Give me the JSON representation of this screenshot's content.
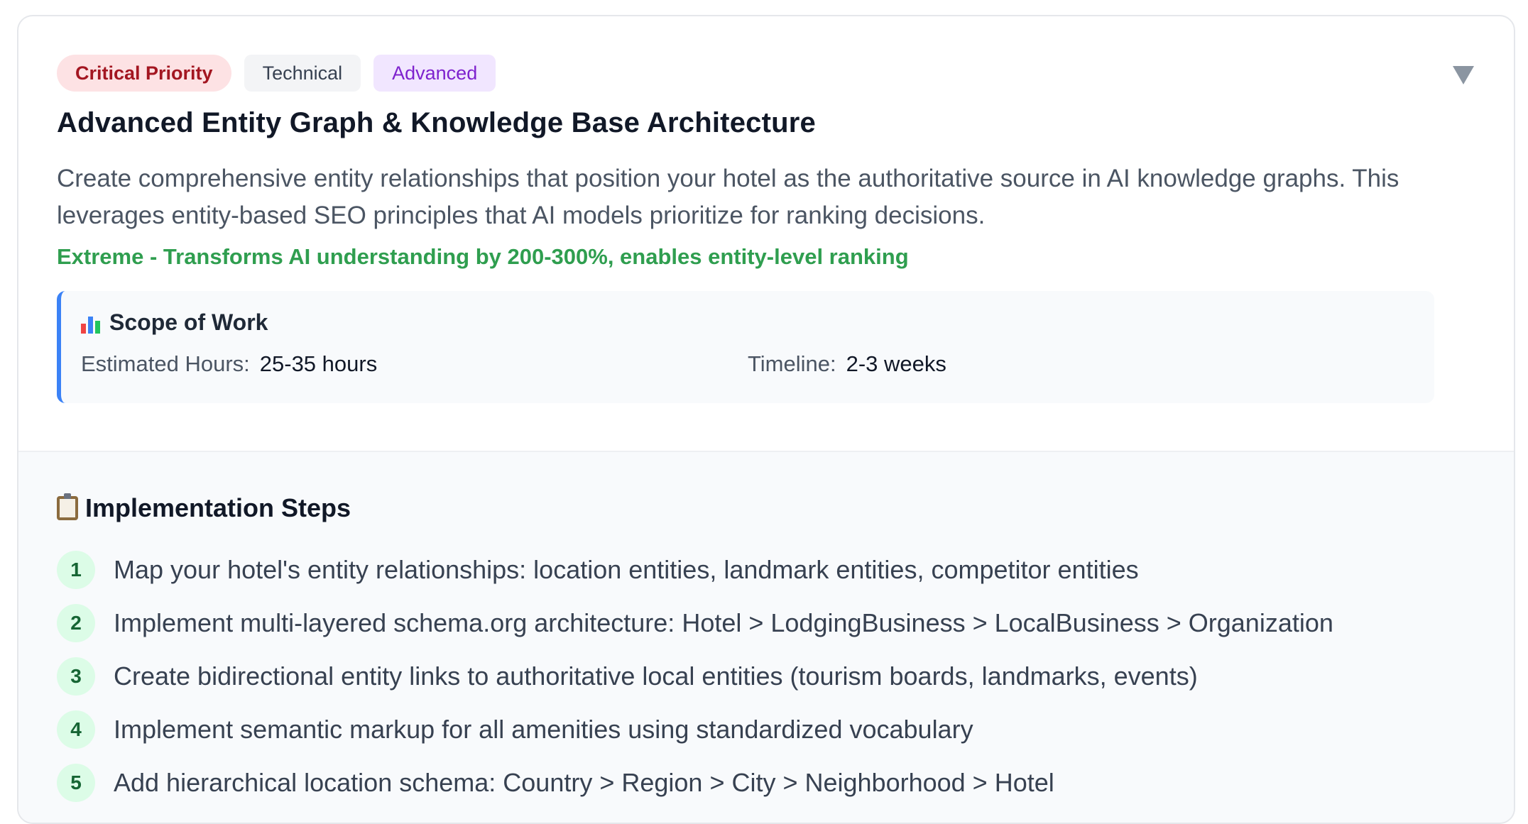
{
  "badges": {
    "priority": "Critical Priority",
    "category": "Technical",
    "level": "Advanced"
  },
  "title": "Advanced Entity Graph & Knowledge Base Architecture",
  "description": "Create comprehensive entity relationships that position your hotel as the authoritative source in AI knowledge graphs. This leverages entity-based SEO principles that AI models prioritize for ranking decisions.",
  "impact": "Extreme - Transforms AI understanding by 200-300%, enables entity-level ranking",
  "scope": {
    "title": "Scope of Work",
    "icon": "bar-chart-icon",
    "hours_label": "Estimated Hours:",
    "hours_value": "25-35 hours",
    "timeline_label": "Timeline:",
    "timeline_value": "2-3 weeks"
  },
  "steps_section": {
    "title": "Implementation Steps",
    "icon": "clipboard-icon",
    "steps": [
      {
        "num": "1",
        "text": "Map your hotel's entity relationships: location entities, landmark entities, competitor entities"
      },
      {
        "num": "2",
        "text": "Implement multi-layered schema.org architecture: Hotel > LodgingBusiness > LocalBusiness > Organization"
      },
      {
        "num": "3",
        "text": "Create bidirectional entity links to authoritative local entities (tourism boards, landmarks, events)"
      },
      {
        "num": "4",
        "text": "Implement semantic markup for all amenities using standardized vocabulary"
      },
      {
        "num": "5",
        "text": "Add hierarchical location schema: Country > Region > City > Neighborhood > Hotel"
      }
    ]
  },
  "colors": {
    "accent_border": "#3b82f6",
    "impact_green": "#2f9e4f",
    "critical_bg": "#fde2e4",
    "critical_text": "#a31621"
  }
}
